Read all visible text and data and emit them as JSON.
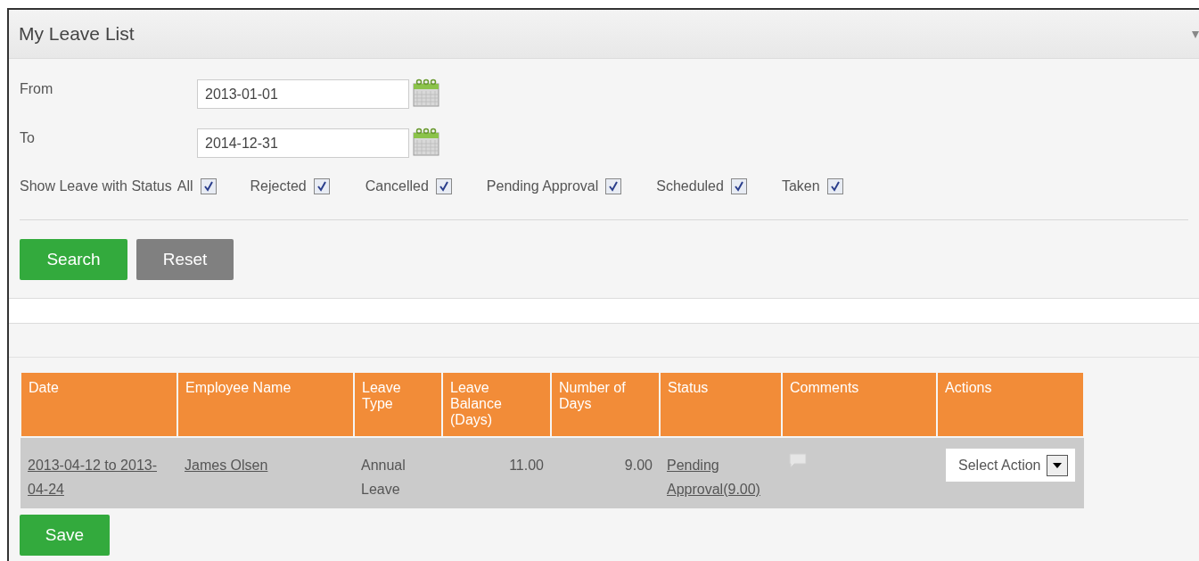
{
  "panel": {
    "title": "My Leave List",
    "collapsed": false
  },
  "filters": {
    "fields": [
      {
        "label": "From",
        "value": "2013-01-01"
      },
      {
        "label": "To",
        "value": "2014-12-31"
      }
    ],
    "status_label": "Show Leave with Status",
    "statuses": [
      {
        "label": "All",
        "checked": true
      },
      {
        "label": "Rejected",
        "checked": true
      },
      {
        "label": "Cancelled",
        "checked": true
      },
      {
        "label": "Pending Approval",
        "checked": true
      },
      {
        "label": "Scheduled",
        "checked": true
      },
      {
        "label": "Taken",
        "checked": true
      }
    ]
  },
  "buttons": [
    {
      "label": "Search",
      "kind": "primary"
    },
    {
      "label": "Reset",
      "kind": "secondary"
    }
  ],
  "table": {
    "columns": [
      "Date",
      "Employee Name",
      "Leave Type",
      "Leave Balance (Days)",
      "Number of Days",
      "Status",
      "Comments",
      "Actions"
    ],
    "rows": [
      {
        "date": "2013-04-12 to 2013-04-24",
        "employee": "James Olsen",
        "leave_type": "Annual Leave",
        "balance": "11.00",
        "days": "9.00",
        "status": "Pending Approval(9.00)",
        "action": "Select Action"
      }
    ]
  },
  "save_button": "Save"
}
